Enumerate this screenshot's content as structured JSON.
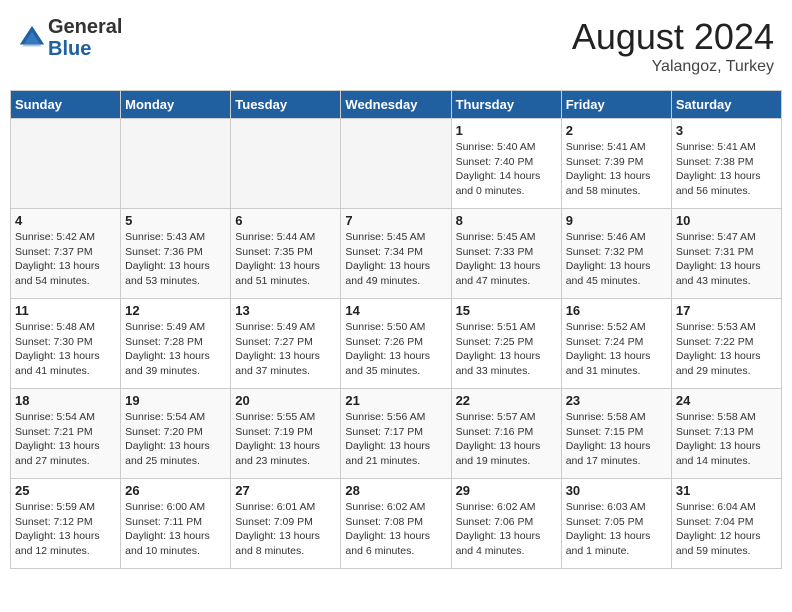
{
  "header": {
    "logo_line1": "General",
    "logo_line2": "Blue",
    "month": "August 2024",
    "location": "Yalangoz, Turkey"
  },
  "weekdays": [
    "Sunday",
    "Monday",
    "Tuesday",
    "Wednesday",
    "Thursday",
    "Friday",
    "Saturday"
  ],
  "weeks": [
    [
      {
        "day": "",
        "info": ""
      },
      {
        "day": "",
        "info": ""
      },
      {
        "day": "",
        "info": ""
      },
      {
        "day": "",
        "info": ""
      },
      {
        "day": "1",
        "info": "Sunrise: 5:40 AM\nSunset: 7:40 PM\nDaylight: 14 hours\nand 0 minutes."
      },
      {
        "day": "2",
        "info": "Sunrise: 5:41 AM\nSunset: 7:39 PM\nDaylight: 13 hours\nand 58 minutes."
      },
      {
        "day": "3",
        "info": "Sunrise: 5:41 AM\nSunset: 7:38 PM\nDaylight: 13 hours\nand 56 minutes."
      }
    ],
    [
      {
        "day": "4",
        "info": "Sunrise: 5:42 AM\nSunset: 7:37 PM\nDaylight: 13 hours\nand 54 minutes."
      },
      {
        "day": "5",
        "info": "Sunrise: 5:43 AM\nSunset: 7:36 PM\nDaylight: 13 hours\nand 53 minutes."
      },
      {
        "day": "6",
        "info": "Sunrise: 5:44 AM\nSunset: 7:35 PM\nDaylight: 13 hours\nand 51 minutes."
      },
      {
        "day": "7",
        "info": "Sunrise: 5:45 AM\nSunset: 7:34 PM\nDaylight: 13 hours\nand 49 minutes."
      },
      {
        "day": "8",
        "info": "Sunrise: 5:45 AM\nSunset: 7:33 PM\nDaylight: 13 hours\nand 47 minutes."
      },
      {
        "day": "9",
        "info": "Sunrise: 5:46 AM\nSunset: 7:32 PM\nDaylight: 13 hours\nand 45 minutes."
      },
      {
        "day": "10",
        "info": "Sunrise: 5:47 AM\nSunset: 7:31 PM\nDaylight: 13 hours\nand 43 minutes."
      }
    ],
    [
      {
        "day": "11",
        "info": "Sunrise: 5:48 AM\nSunset: 7:30 PM\nDaylight: 13 hours\nand 41 minutes."
      },
      {
        "day": "12",
        "info": "Sunrise: 5:49 AM\nSunset: 7:28 PM\nDaylight: 13 hours\nand 39 minutes."
      },
      {
        "day": "13",
        "info": "Sunrise: 5:49 AM\nSunset: 7:27 PM\nDaylight: 13 hours\nand 37 minutes."
      },
      {
        "day": "14",
        "info": "Sunrise: 5:50 AM\nSunset: 7:26 PM\nDaylight: 13 hours\nand 35 minutes."
      },
      {
        "day": "15",
        "info": "Sunrise: 5:51 AM\nSunset: 7:25 PM\nDaylight: 13 hours\nand 33 minutes."
      },
      {
        "day": "16",
        "info": "Sunrise: 5:52 AM\nSunset: 7:24 PM\nDaylight: 13 hours\nand 31 minutes."
      },
      {
        "day": "17",
        "info": "Sunrise: 5:53 AM\nSunset: 7:22 PM\nDaylight: 13 hours\nand 29 minutes."
      }
    ],
    [
      {
        "day": "18",
        "info": "Sunrise: 5:54 AM\nSunset: 7:21 PM\nDaylight: 13 hours\nand 27 minutes."
      },
      {
        "day": "19",
        "info": "Sunrise: 5:54 AM\nSunset: 7:20 PM\nDaylight: 13 hours\nand 25 minutes."
      },
      {
        "day": "20",
        "info": "Sunrise: 5:55 AM\nSunset: 7:19 PM\nDaylight: 13 hours\nand 23 minutes."
      },
      {
        "day": "21",
        "info": "Sunrise: 5:56 AM\nSunset: 7:17 PM\nDaylight: 13 hours\nand 21 minutes."
      },
      {
        "day": "22",
        "info": "Sunrise: 5:57 AM\nSunset: 7:16 PM\nDaylight: 13 hours\nand 19 minutes."
      },
      {
        "day": "23",
        "info": "Sunrise: 5:58 AM\nSunset: 7:15 PM\nDaylight: 13 hours\nand 17 minutes."
      },
      {
        "day": "24",
        "info": "Sunrise: 5:58 AM\nSunset: 7:13 PM\nDaylight: 13 hours\nand 14 minutes."
      }
    ],
    [
      {
        "day": "25",
        "info": "Sunrise: 5:59 AM\nSunset: 7:12 PM\nDaylight: 13 hours\nand 12 minutes."
      },
      {
        "day": "26",
        "info": "Sunrise: 6:00 AM\nSunset: 7:11 PM\nDaylight: 13 hours\nand 10 minutes."
      },
      {
        "day": "27",
        "info": "Sunrise: 6:01 AM\nSunset: 7:09 PM\nDaylight: 13 hours\nand 8 minutes."
      },
      {
        "day": "28",
        "info": "Sunrise: 6:02 AM\nSunset: 7:08 PM\nDaylight: 13 hours\nand 6 minutes."
      },
      {
        "day": "29",
        "info": "Sunrise: 6:02 AM\nSunset: 7:06 PM\nDaylight: 13 hours\nand 4 minutes."
      },
      {
        "day": "30",
        "info": "Sunrise: 6:03 AM\nSunset: 7:05 PM\nDaylight: 13 hours\nand 1 minute."
      },
      {
        "day": "31",
        "info": "Sunrise: 6:04 AM\nSunset: 7:04 PM\nDaylight: 12 hours\nand 59 minutes."
      }
    ]
  ]
}
